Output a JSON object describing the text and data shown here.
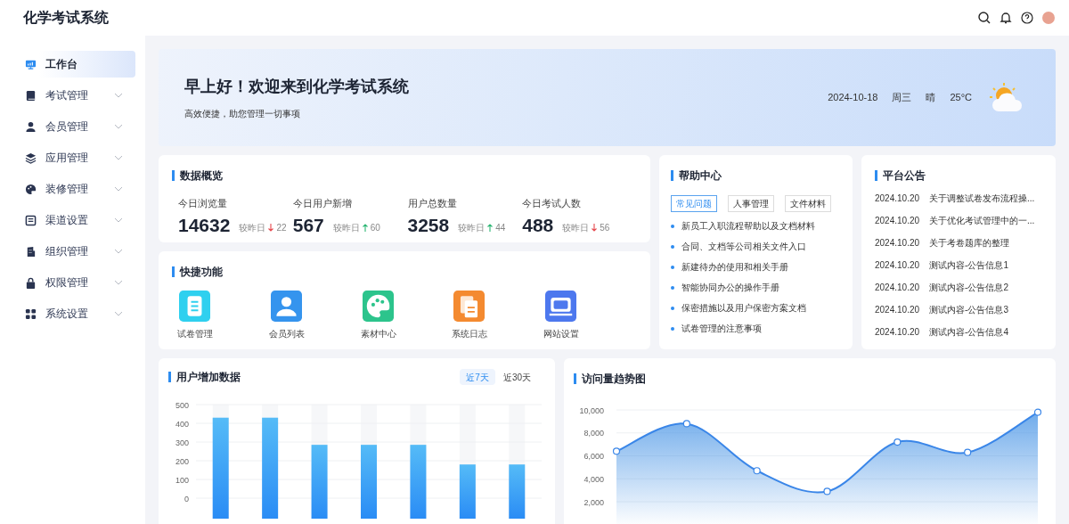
{
  "app": {
    "title": "化学考试系统"
  },
  "sidebar": {
    "items": [
      {
        "label": "工作台",
        "selected": true,
        "expandable": false
      },
      {
        "label": "考试管理",
        "selected": false,
        "expandable": true
      },
      {
        "label": "会员管理",
        "selected": false,
        "expandable": true
      },
      {
        "label": "应用管理",
        "selected": false,
        "expandable": true
      },
      {
        "label": "装修管理",
        "selected": false,
        "expandable": true
      },
      {
        "label": "渠道设置",
        "selected": false,
        "expandable": true
      },
      {
        "label": "组织管理",
        "selected": false,
        "expandable": true
      },
      {
        "label": "权限管理",
        "selected": false,
        "expandable": true
      },
      {
        "label": "系统设置",
        "selected": false,
        "expandable": true
      }
    ]
  },
  "banner": {
    "greeting": "早上好！欢迎来到化学考试系统",
    "subtitle": "高效便捷，助您管理一切事项",
    "date": "2024-10-18",
    "weekday": "周三",
    "weather": "晴",
    "temperature": "25°C"
  },
  "overview": {
    "title": "数据概览",
    "stats": [
      {
        "label": "今日浏览量",
        "value": "14632",
        "compare": "较昨日",
        "change": "22",
        "up": false
      },
      {
        "label": "今日用户新增",
        "value": "567",
        "compare": "较昨日",
        "change": "60",
        "up": true
      },
      {
        "label": "用户总数量",
        "value": "3258",
        "compare": "较昨日",
        "change": "44",
        "up": true
      },
      {
        "label": "今日考试人数",
        "value": "488",
        "compare": "较昨日",
        "change": "56",
        "up": false
      }
    ]
  },
  "shortcuts": {
    "title": "快捷功能",
    "items": [
      {
        "label": "试卷管理",
        "color": "#2fd0ef"
      },
      {
        "label": "会员列表",
        "color": "#3594ee"
      },
      {
        "label": "素材中心",
        "color": "#2cc48c"
      },
      {
        "label": "系统日志",
        "color": "#f48a30"
      },
      {
        "label": "网站设置",
        "color": "#4d78ee"
      }
    ]
  },
  "help": {
    "title": "帮助中心",
    "tabs": [
      {
        "label": "常见问题",
        "selected": true
      },
      {
        "label": "人事管理",
        "selected": false
      },
      {
        "label": "文件材料",
        "selected": false
      }
    ],
    "items": [
      "新员工入职流程帮助以及文档材料",
      "合同、文档等公司相关文件入口",
      "新建待办的使用和相关手册",
      "智能协同办公的操作手册",
      "保密措施以及用户保密方案文档",
      "试卷管理的注意事项"
    ]
  },
  "announcements": {
    "title": "平台公告",
    "items": [
      {
        "date": "2024.10.20",
        "text": "关于调整试卷发布流程操..."
      },
      {
        "date": "2024.10.20",
        "text": "关于优化考试管理中的一..."
      },
      {
        "date": "2024.10.20",
        "text": "关于考卷题库的整理"
      },
      {
        "date": "2024.10.20",
        "text": "测试内容-公告信息1"
      },
      {
        "date": "2024.10.20",
        "text": "测试内容-公告信息2"
      },
      {
        "date": "2024.10.20",
        "text": "测试内容-公告信息3"
      },
      {
        "date": "2024.10.20",
        "text": "测试内容-公告信息4"
      }
    ]
  },
  "user_growth": {
    "title": "用户增加数据",
    "ranges": [
      {
        "label": "近7天",
        "selected": true
      },
      {
        "label": "近30天",
        "selected": false
      }
    ],
    "chart_data": {
      "type": "bar",
      "values": [
        430,
        430,
        285,
        285,
        285,
        180,
        180
      ],
      "ylim": [
        0,
        500
      ],
      "grid": true,
      "yticks": [
        0,
        100,
        200,
        300,
        400,
        500
      ]
    }
  },
  "visits": {
    "title": "访问量趋势图",
    "chart_data": {
      "type": "area",
      "values": [
        6400,
        8800,
        4700,
        2900,
        7200,
        6300,
        9800
      ],
      "ylim": [
        0,
        10000
      ],
      "grid": true,
      "yticks": [
        {
          "value": 2000,
          "label": "2,000"
        },
        {
          "value": 4000,
          "label": "4,000"
        },
        {
          "value": 6000,
          "label": "6,000"
        },
        {
          "value": 8000,
          "label": "8,000"
        },
        {
          "value": 10000,
          "label": "10,000"
        }
      ]
    }
  }
}
